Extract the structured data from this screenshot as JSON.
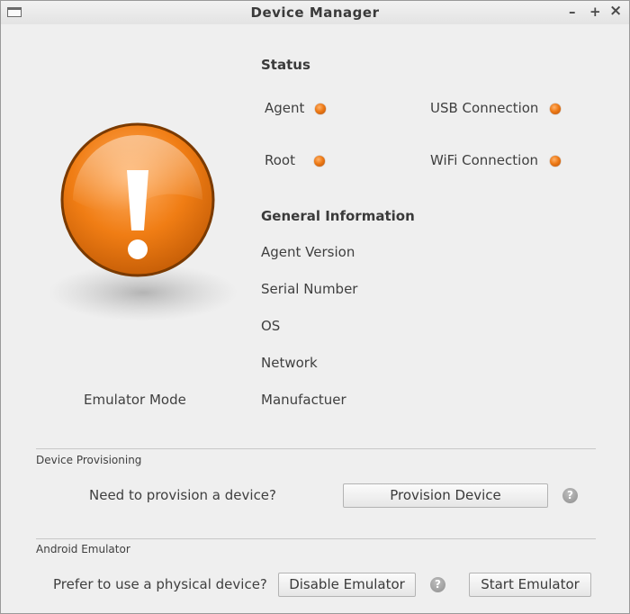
{
  "window": {
    "title": "Device Manager",
    "minimize_glyph": "–",
    "maximize_glyph": "+",
    "close_glyph": "×"
  },
  "status_icon": {
    "icon": "warning-exclamation-icon",
    "color": "#f07d14"
  },
  "emulator_mode_label": "Emulator Mode",
  "status": {
    "heading": "Status",
    "agent_label": "Agent",
    "root_label": "Root",
    "usb_label": "USB Connection",
    "wifi_label": "WiFi Connection",
    "indicator_color": "#ee7a16"
  },
  "general_info": {
    "heading": "General Information",
    "agent_version_label": "Agent Version",
    "serial_number_label": "Serial Number",
    "os_label": "OS",
    "network_label": "Network",
    "manufacturer_label": "Manufactuer"
  },
  "provisioning": {
    "section_label": "Device Provisioning",
    "prompt": "Need to provision a device?",
    "button_label": "Provision Device",
    "help_glyph": "?"
  },
  "emulator": {
    "section_label": "Android Emulator",
    "prompt": "Prefer to use a physical device?",
    "disable_button_label": "Disable Emulator",
    "start_button_label": "Start Emulator",
    "help_glyph": "?"
  }
}
